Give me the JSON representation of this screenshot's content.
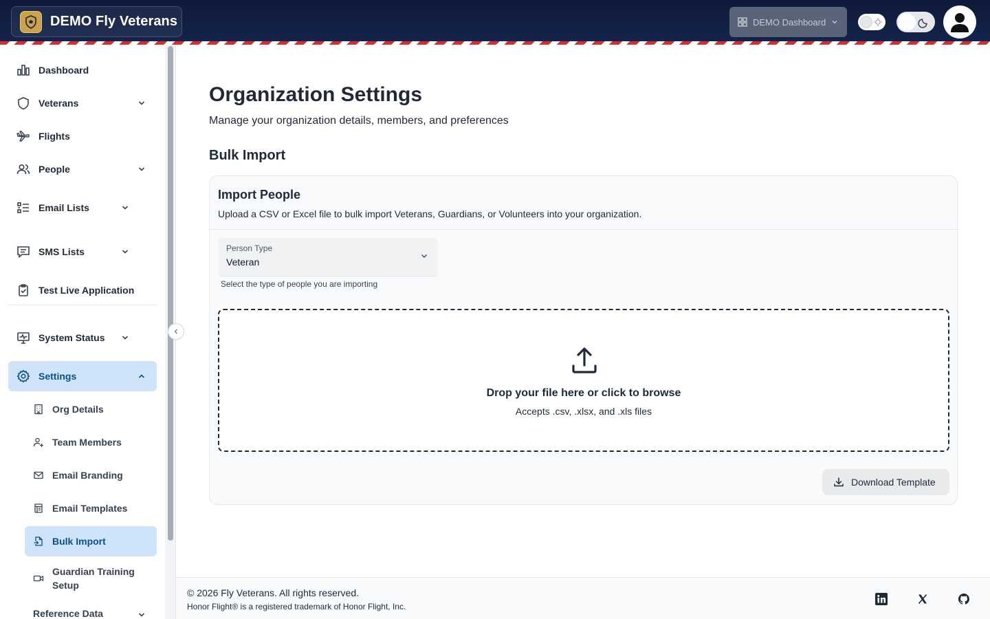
{
  "header": {
    "brand_name": "DEMO Fly Veterans",
    "dashboard_select": "DEMO Dashboard"
  },
  "sidebar": {
    "items": [
      {
        "label": "Dashboard",
        "icon": "bar-chart-icon"
      },
      {
        "label": "Veterans",
        "icon": "shield-icon"
      },
      {
        "label": "Flights",
        "icon": "plane-icon"
      },
      {
        "label": "People",
        "icon": "users-icon"
      },
      {
        "label": "Email Lists",
        "icon": "list-icon"
      },
      {
        "label": "SMS Lists",
        "icon": "message-icon"
      },
      {
        "label": "Test Live Application",
        "icon": "clipboard-check-icon"
      },
      {
        "label": "System Status",
        "icon": "monitor-icon"
      },
      {
        "label": "Settings",
        "icon": "gear-icon"
      }
    ],
    "settings_children": [
      {
        "label": "Org Details",
        "icon": "building-icon"
      },
      {
        "label": "Team Members",
        "icon": "user-plus-icon"
      },
      {
        "label": "Email Branding",
        "icon": "mail-icon"
      },
      {
        "label": "Email Templates",
        "icon": "template-icon"
      },
      {
        "label": "Bulk Import",
        "icon": "file-import-icon"
      },
      {
        "label": "Guardian Training Setup",
        "icon": "video-icon"
      }
    ],
    "reference_data": "Reference Data"
  },
  "main": {
    "title": "Organization Settings",
    "subtitle": "Manage your organization details, members, and preferences",
    "section_title": "Bulk Import",
    "card": {
      "title": "Import People",
      "description": "Upload a CSV or Excel file to bulk import Veterans, Guardians, or Volunteers into your organization.",
      "person_type_label": "Person Type",
      "person_type_value": "Veteran",
      "helper": "Select the type of people you are importing",
      "drop_title": "Drop your file here or click to browse",
      "drop_sub": "Accepts .csv, .xlsx, and .xls files",
      "download_label": "Download Template"
    }
  },
  "footer": {
    "copyright": "© 2026 Fly Veterans. All rights reserved.",
    "trademark": "Honor Flight® is a registered trademark of Honor Flight, Inc."
  },
  "colors": {
    "header_bg": "#0e1a3a",
    "stripe_red": "#d32f2f",
    "active_bg": "#cfe4f8",
    "active_text": "#0b4f8a"
  }
}
